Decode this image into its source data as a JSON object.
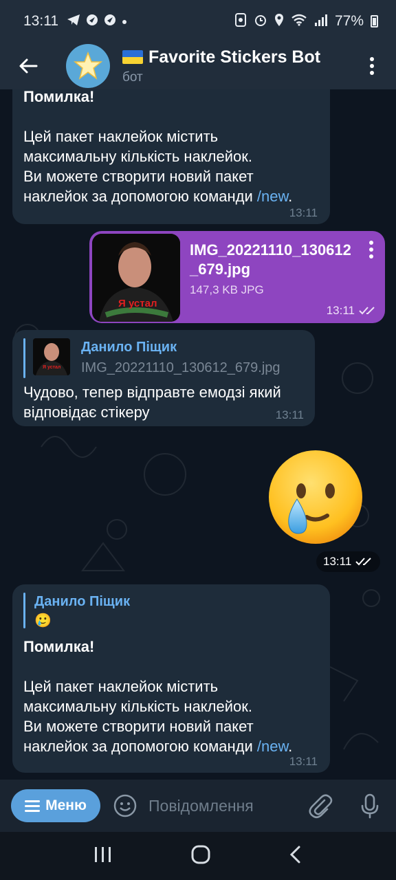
{
  "status_bar": {
    "time": "13:11",
    "battery": "77%"
  },
  "header": {
    "back_icon": "arrow-left-icon",
    "avatar_icon": "star-icon",
    "flag": "ukraine-flag",
    "title": "Favorite Stickers Bot",
    "subtitle": "бот",
    "menu_icon": "more-vertical-icon"
  },
  "messages": {
    "top_bot_message": {
      "heading": "Помилка!",
      "line1": "Цей пакет наклейок містить",
      "line2": "максимальну кількість наклейок.",
      "line3": "Ви можете створити новий пакет",
      "line4_prefix": "наклейок за допомогою команди ",
      "command": "/new",
      "line4_suffix": ".",
      "time": "13:11"
    },
    "file_message": {
      "filename_line1": "IMG_20221110_130612",
      "filename_line2": "_679.jpg",
      "size": "147,3 KB JPG",
      "time": "13:11",
      "thumb_caption": "Я устал"
    },
    "reply_message": {
      "reply_name": "Данило Піщик",
      "reply_file": "IMG_20221110_130612_679.jpg",
      "thumb_caption": "Я устал",
      "line1": "Чудово, тепер відправте емодзі який",
      "line2": "відповідає стікеру",
      "time": "13:11"
    },
    "sticker_message": {
      "time": "13:11"
    },
    "bottom_bot_message": {
      "reply_name": "Данило Піщик",
      "reply_emoji": "🥲",
      "heading": "Помилка!",
      "line1": "Цей пакет наклейок містить",
      "line2": "максимальну кількість наклейок.",
      "line3": "Ви можете створити новий пакет",
      "line4_prefix": "наклейок за допомогою команди ",
      "command": "/new",
      "line4_suffix": ".",
      "time": "13:11"
    }
  },
  "input_bar": {
    "menu_label": "Меню",
    "placeholder": "Повідомлення"
  },
  "colors": {
    "accent": "#6ab2f2",
    "outgoing_bubble": "#8e45c0",
    "incoming_bubble": "#1e2c3a"
  }
}
